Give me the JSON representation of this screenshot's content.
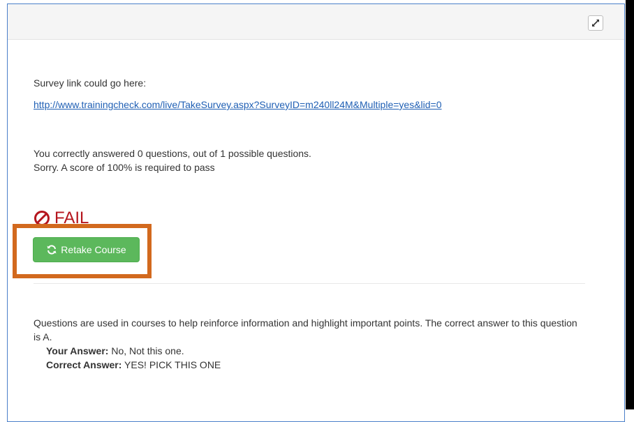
{
  "survey": {
    "label": "Survey link could go here:",
    "link": "http://www.trainingcheck.com/live/TakeSurvey.aspx?SurveyID=m240ll24M&Multiple=yes&lid=0"
  },
  "result": {
    "score_text": "You correctly answered 0 questions, out of 1 possible questions.",
    "pass_text": "Sorry. A score of 100% is required to pass",
    "status": "FAIL",
    "retake_label": "Retake Course"
  },
  "explanation": {
    "text": "Questions are used in courses to help reinforce information and highlight important points. The correct answer to this question is A.",
    "your_answer_label": "Your Answer:",
    "your_answer_value": "No, Not this one.",
    "correct_answer_label": "Correct Answer:",
    "correct_answer_value": "YES! PICK THIS ONE"
  },
  "colors": {
    "fail": "#b5161e",
    "success_button": "#5cb85c",
    "highlight": "#d2691e",
    "link": "#1f5fb4"
  },
  "icons": {
    "expand": "expand-icon",
    "fail": "ban-icon",
    "retake": "refresh-icon"
  }
}
